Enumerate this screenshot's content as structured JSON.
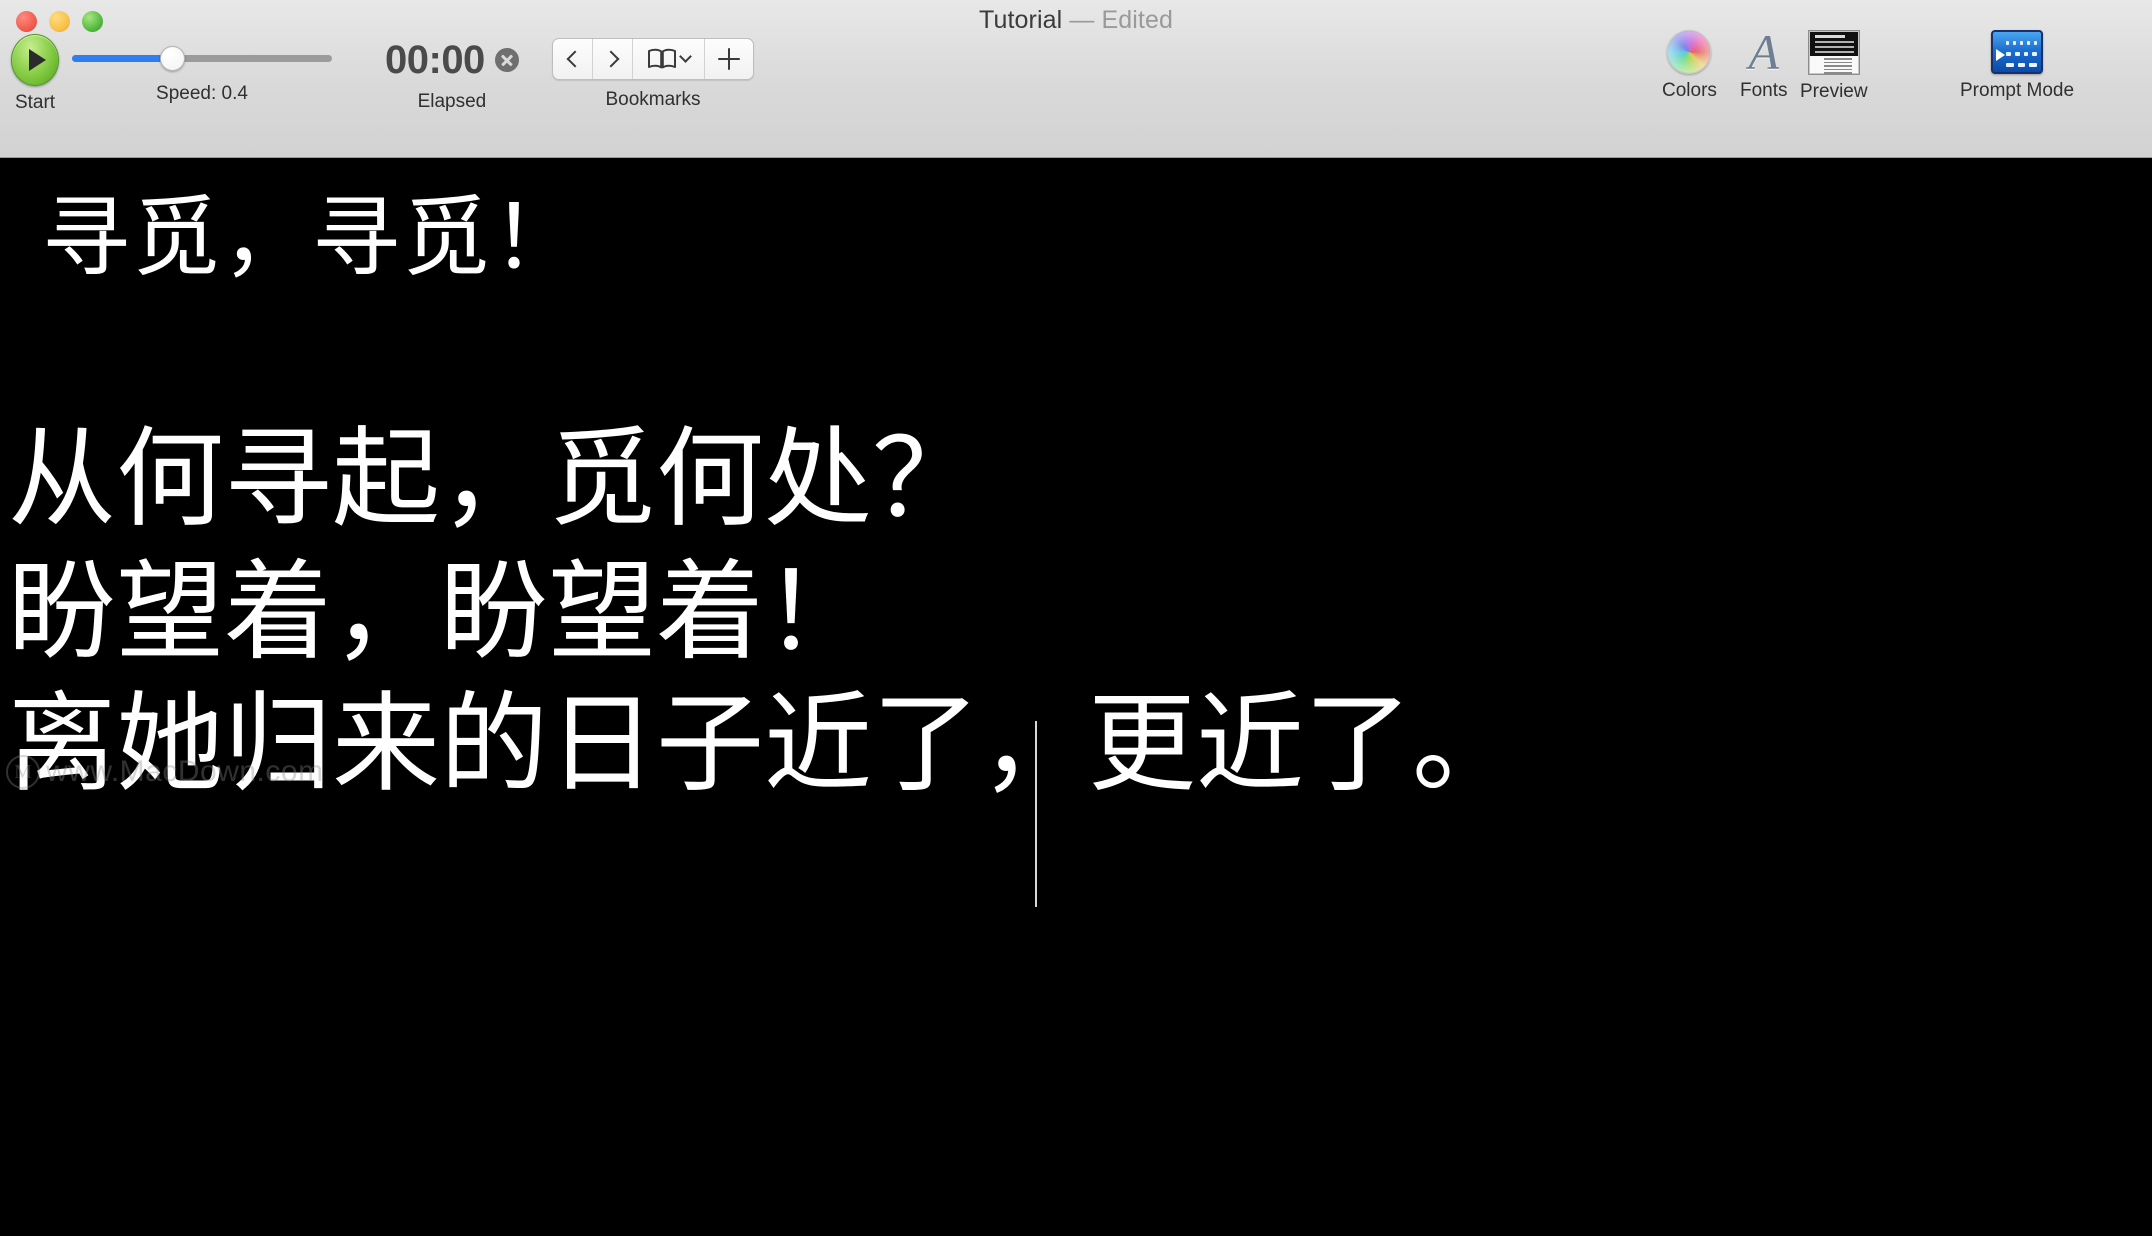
{
  "window": {
    "title": "Tutorial",
    "dash": "—",
    "edited": "Edited",
    "traffic_lights": [
      "close",
      "minimize",
      "zoom"
    ]
  },
  "toolbar": {
    "start": {
      "label": "Start",
      "icon": "play-icon"
    },
    "speed": {
      "label": "Speed:  0.4",
      "value": 0.4,
      "fill_percent": 39
    },
    "elapsed": {
      "time": "00:00",
      "label": "Elapsed",
      "clear_icon": "clear-circle-icon"
    },
    "bookmarks": {
      "label": "Bookmarks",
      "prev_icon": "chevron-left-icon",
      "next_icon": "chevron-right-icon",
      "book_icon": "open-book-icon",
      "dropdown_icon": "chevron-down-icon",
      "add_icon": "plus-icon"
    },
    "colors": {
      "label": "Colors",
      "icon": "color-wheel-icon"
    },
    "fonts": {
      "label": "Fonts",
      "icon": "font-a-icon",
      "glyph": "A"
    },
    "preview": {
      "label": "Preview",
      "icon": "preview-window-icon"
    },
    "prompt_mode": {
      "label": "Prompt Mode",
      "icon": "prompt-mode-icon"
    }
  },
  "canvas": {
    "background_color": "#000000",
    "text_color": "#FFFFFF",
    "lines": [
      "寻觅，寻觅！",
      "从何寻起，觅何处？",
      "盼望着，盼望着！",
      "离她归来的日子近了，更近了。"
    ],
    "caret_visible": true
  },
  "watermark": {
    "logo": "M",
    "text": "www.MacDown.com"
  }
}
